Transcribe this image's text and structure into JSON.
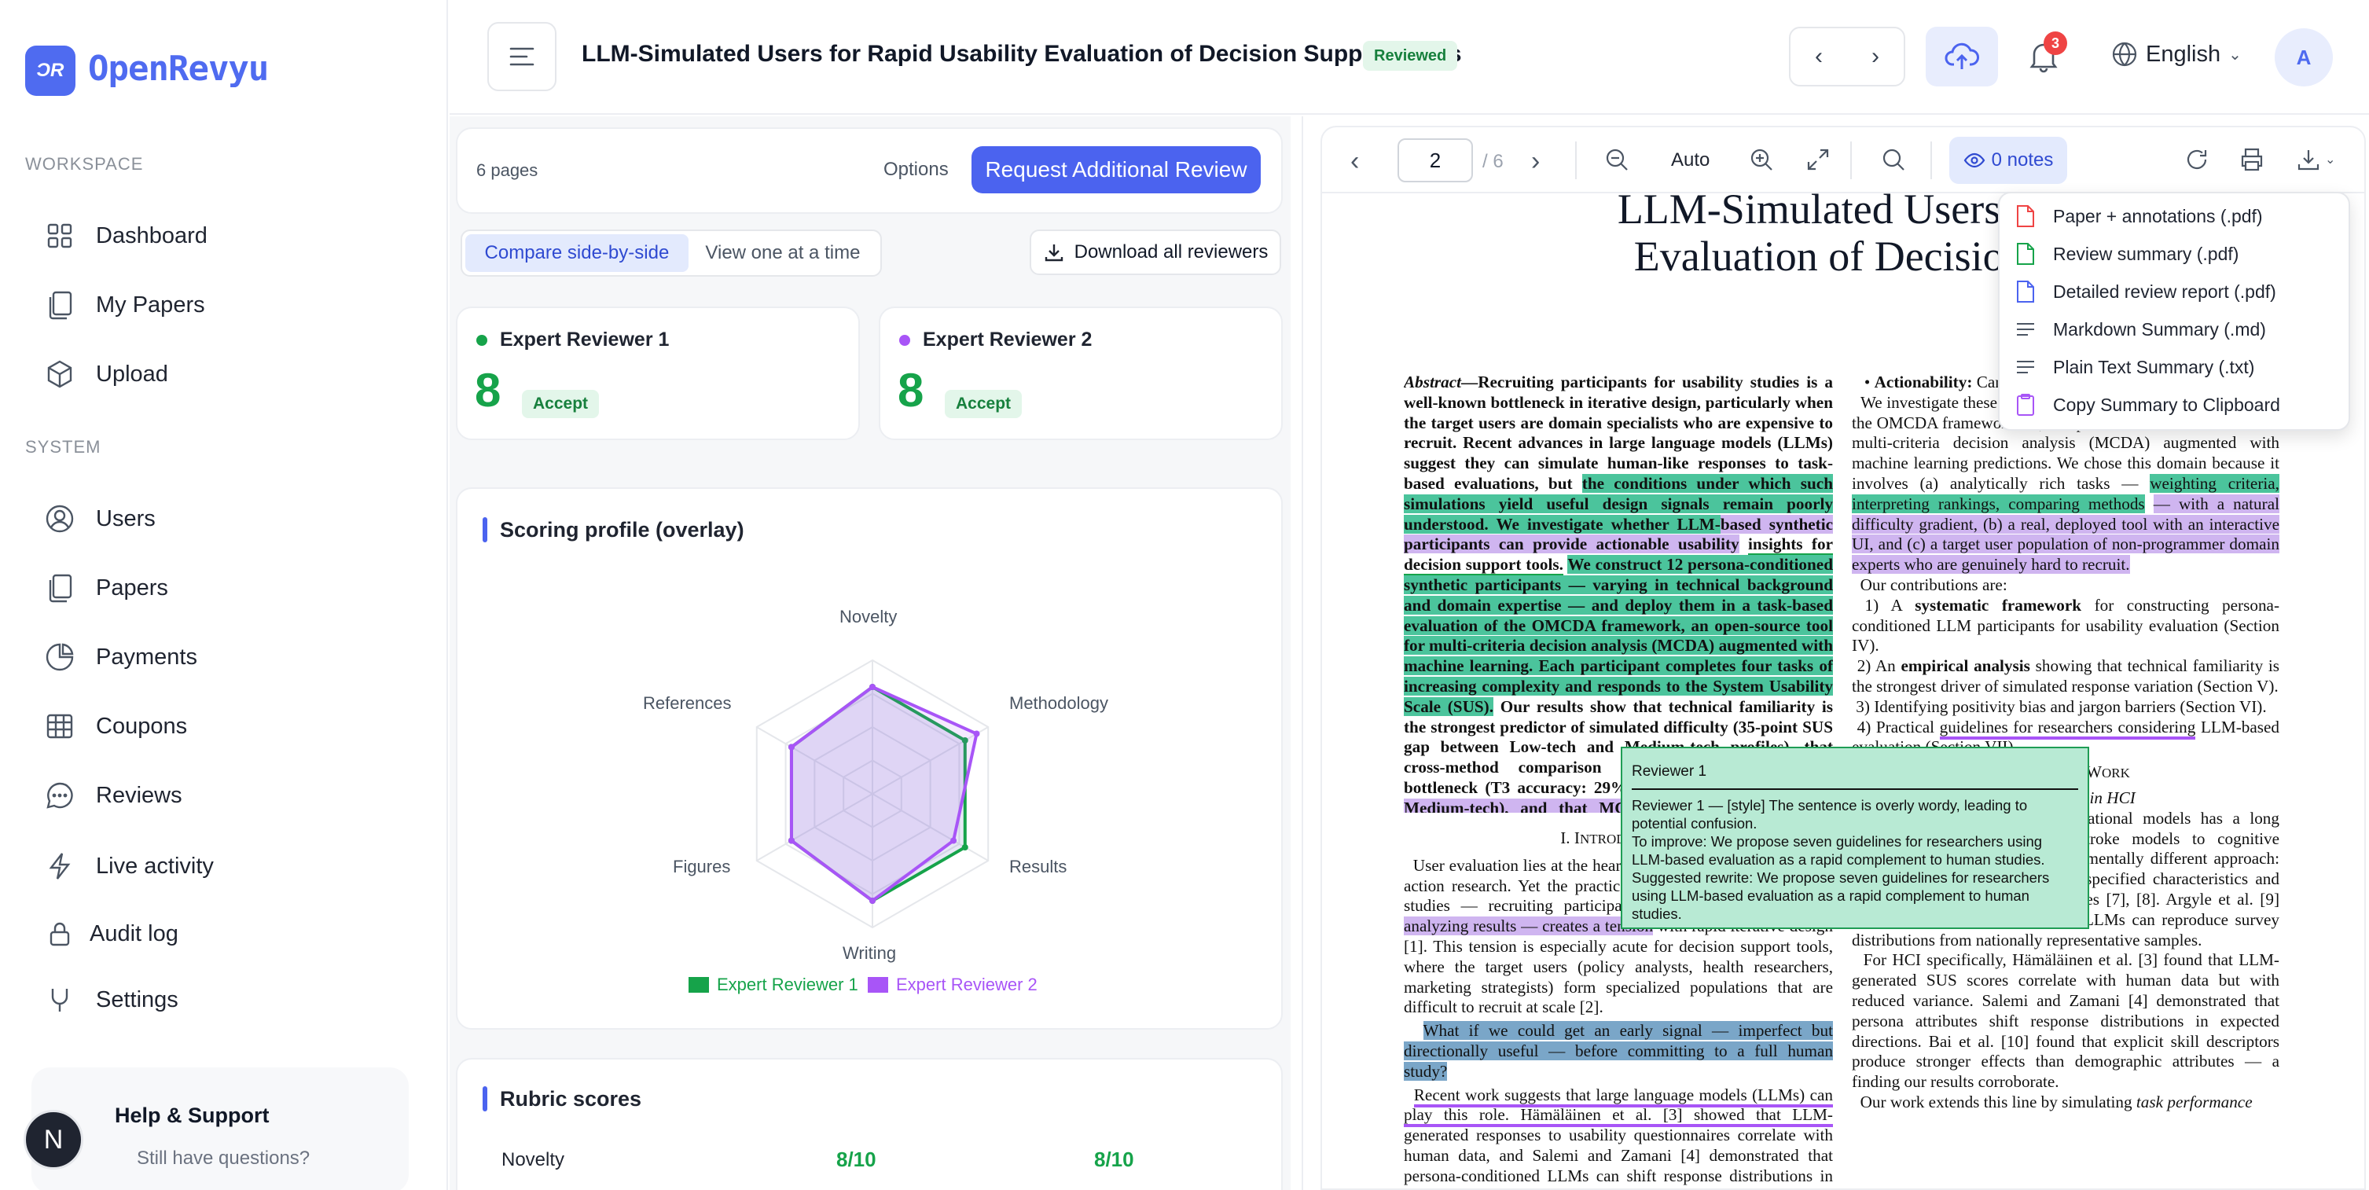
{
  "sidebar": {
    "logo_mark": "ƆR",
    "brand": "OpenRevyu",
    "workspace_label": "WORKSPACE",
    "workspace_items": [
      {
        "label": "Dashboard",
        "icon": "grid-icon"
      },
      {
        "label": "My Papers",
        "icon": "files-icon"
      },
      {
        "label": "Upload",
        "icon": "cube-icon"
      }
    ],
    "system_label": "SYSTEM",
    "system_items": [
      {
        "label": "Users",
        "icon": "user-circle-icon"
      },
      {
        "label": "Papers",
        "icon": "files-icon"
      },
      {
        "label": "Payments",
        "icon": "pie-chart-icon"
      },
      {
        "label": "Coupons",
        "icon": "table-icon"
      },
      {
        "label": "Reviews",
        "icon": "chat-icon"
      },
      {
        "label": "Live activity",
        "icon": "bolt-icon"
      },
      {
        "label": "Audit log",
        "icon": "lock-icon"
      },
      {
        "label": "Settings",
        "icon": "plug-icon"
      }
    ],
    "help_title": "Help & Support",
    "help_sub": "Still have questions?",
    "avatar_letter": "N"
  },
  "header": {
    "title": "LLM-Simulated Users for Rapid Usability Evaluation of Decision Support Tools",
    "status_badge": "Reviewed",
    "notification_count": "3",
    "language": "English",
    "user_initial": "A"
  },
  "review_panel": {
    "pages": "6 pages",
    "options": "Options",
    "request_button": "Request Additional Review",
    "view_modes": [
      "Compare side-by-side",
      "View one at a time"
    ],
    "active_view_mode": "Compare side-by-side",
    "download_all": "Download all reviewers",
    "reviewers": [
      {
        "name": "Expert Reviewer 1",
        "score": "8",
        "decision": "Accept",
        "color": "#16a34a"
      },
      {
        "name": "Expert Reviewer 2",
        "score": "8",
        "decision": "Accept",
        "color": "#a855f7"
      }
    ],
    "scoring_title": "Scoring profile (overlay)",
    "radar_axes": [
      "Novelty",
      "Methodology",
      "Results",
      "Writing",
      "Figures",
      "References"
    ],
    "rubric_title": "Rubric scores",
    "rubric_rows": [
      {
        "criterion": "Novelty",
        "r1": "8/10",
        "r2": "8/10"
      }
    ]
  },
  "chart_data": {
    "type": "radar",
    "title": "Scoring profile (overlay)",
    "axes": [
      "Novelty",
      "Methodology",
      "Results",
      "Writing",
      "Figures",
      "References"
    ],
    "max": 10,
    "series": [
      {
        "name": "Expert Reviewer 1",
        "color": "#16a34a",
        "values": [
          8,
          8,
          8,
          8,
          7,
          7
        ]
      },
      {
        "name": "Expert Reviewer 2",
        "color": "#a855f7",
        "values": [
          8,
          9,
          7,
          8,
          7,
          7
        ]
      }
    ]
  },
  "viewer": {
    "page": "2",
    "page_total": "/ 6",
    "zoom": "Auto",
    "notes": "0 notes",
    "paper_title_line1": "LLM-Simulated Users for Rap",
    "paper_title_line2": "Evaluation of Decision Supp",
    "export_menu": [
      {
        "label": "Paper + annotations (.pdf)",
        "icon": "pdf-icon",
        "color": "#ef4444"
      },
      {
        "label": "Review summary (.pdf)",
        "icon": "doc-icon",
        "color": "#16a34a"
      },
      {
        "label": "Detailed review report (.pdf)",
        "icon": "doc-icon",
        "color": "#4b63ef"
      },
      {
        "label": "Markdown Summary (.md)",
        "icon": "lines-icon",
        "color": "#4b5563"
      },
      {
        "label": "Plain Text Summary (.txt)",
        "icon": "lines-icon",
        "color": "#4b5563"
      },
      {
        "label": "Copy Summary to Clipboard",
        "icon": "clipboard-icon",
        "color": "#a855f7"
      }
    ],
    "tooltip": {
      "head": "Reviewer 1",
      "body": "Reviewer 1 — [style] The sentence is overly wordy, leading to potential confusion.",
      "improve": "To improve: We propose seven guidelines for researchers using LLM-based evaluation as a rapid complement to human studies.",
      "rewrite": "Suggested rewrite: We propose seven guidelines for researchers using LLM-based evaluation as a rapid complement to human studies."
    }
  }
}
